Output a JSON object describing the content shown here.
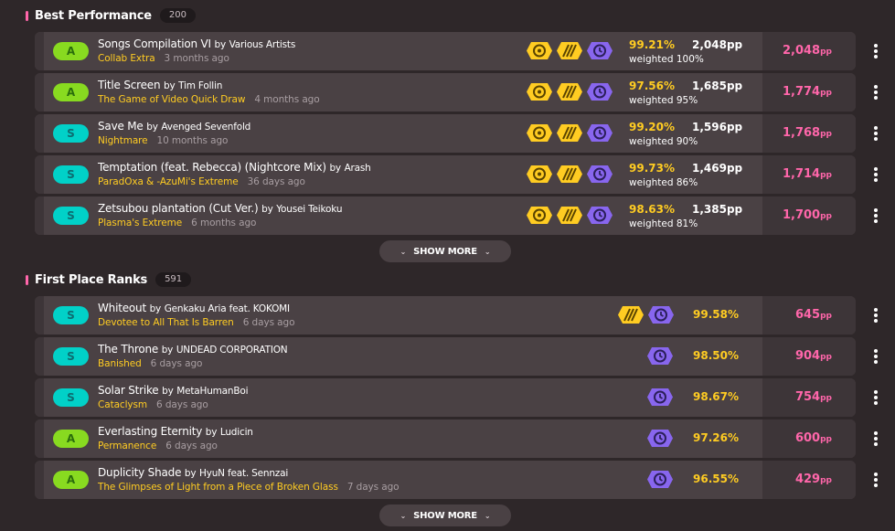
{
  "best_performance": {
    "title": "Best Performance",
    "count": "200",
    "show_more": "SHOW MORE",
    "rows": [
      {
        "grade": "A",
        "title": "Songs Compilation VI",
        "by": "by",
        "artist": "Various Artists",
        "difficulty": "Collab Extra",
        "ago": "3 months ago",
        "accuracy": "99.21%",
        "pp_raw": "2,048pp",
        "weighted": "weighted 100%",
        "pp": "2,048",
        "unit": "pp"
      },
      {
        "grade": "A",
        "title": "Title Screen",
        "by": "by",
        "artist": "Tim Follin",
        "difficulty": "The Game of Video Quick Draw",
        "ago": "4 months ago",
        "accuracy": "97.56%",
        "pp_raw": "1,685pp",
        "weighted": "weighted 95%",
        "pp": "1,774",
        "unit": "pp"
      },
      {
        "grade": "S",
        "title": "Save Me",
        "by": "by",
        "artist": "Avenged Sevenfold",
        "difficulty": "Nightmare",
        "ago": "10 months ago",
        "accuracy": "99.20%",
        "pp_raw": "1,596pp",
        "weighted": "weighted 90%",
        "pp": "1,768",
        "unit": "pp"
      },
      {
        "grade": "S",
        "title": "Temptation (feat. Rebecca) (Nightcore Mix)",
        "by": "by",
        "artist": "Arash",
        "difficulty": "ParadOxa & -AzuMi's Extreme",
        "ago": "36 days ago",
        "accuracy": "99.73%",
        "pp_raw": "1,469pp",
        "weighted": "weighted 86%",
        "pp": "1,714",
        "unit": "pp"
      },
      {
        "grade": "S",
        "title": "Zetsubou plantation (Cut Ver.)",
        "by": "by",
        "artist": "Yousei Teikoku",
        "difficulty": "Plasma's Extreme",
        "ago": "6 months ago",
        "accuracy": "98.63%",
        "pp_raw": "1,385pp",
        "weighted": "weighted 81%",
        "pp": "1,700",
        "unit": "pp"
      }
    ]
  },
  "first_place": {
    "title": "First Place Ranks",
    "count": "591",
    "show_more": "SHOW MORE",
    "rows": [
      {
        "grade": "S",
        "title": "Whiteout",
        "by": "by",
        "artist": "Genkaku Aria feat. KOKOMI",
        "difficulty": "Devotee to All That Is Barren",
        "ago": "6 days ago",
        "accuracy": "99.58%",
        "pp": "645",
        "unit": "pp"
      },
      {
        "grade": "S",
        "title": "The Throne",
        "by": "by",
        "artist": "UNDEAD CORPORATION",
        "difficulty": "Banished",
        "ago": "6 days ago",
        "accuracy": "98.50%",
        "pp": "904",
        "unit": "pp"
      },
      {
        "grade": "S",
        "title": "Solar Strike",
        "by": "by",
        "artist": "MetaHumanBoi",
        "difficulty": "Cataclysm",
        "ago": "6 days ago",
        "accuracy": "98.67%",
        "pp": "754",
        "unit": "pp"
      },
      {
        "grade": "A",
        "title": "Everlasting Eternity",
        "by": "by",
        "artist": "Ludicin",
        "difficulty": "Permanence",
        "ago": "6 days ago",
        "accuracy": "97.26%",
        "pp": "600",
        "unit": "pp"
      },
      {
        "grade": "A",
        "title": "Duplicity Shade",
        "by": "by",
        "artist": "HyuN feat. Sennzai",
        "difficulty": "The Glimpses of Light from a Piece of Broken Glass",
        "ago": "7 days ago",
        "accuracy": "96.55%",
        "pp": "429",
        "unit": "pp"
      }
    ]
  },
  "icons": {
    "mod_icons": [
      "hidden-mod-icon",
      "hardrock-mod-icon",
      "doubletime-mod-icon",
      "nightcore-mod-icon"
    ],
    "menu": "more-options-icon",
    "chevron": "chevron-down-icon"
  },
  "colors": {
    "background": "#2e2729",
    "row": "#4a4144",
    "accent_pink": "#ff66aa",
    "accuracy_yellow": "#ffcc22",
    "mod_yellow": "#ffcc22",
    "mod_purple": "#8866ee",
    "grade_a": "#88da20",
    "grade_s": "#01d1c8"
  }
}
